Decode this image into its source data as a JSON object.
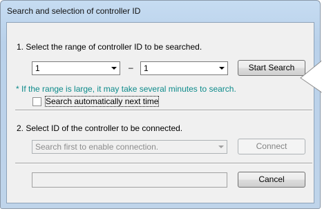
{
  "window": {
    "title": "Search and selection of controller ID"
  },
  "step1": {
    "label": "1. Select the range of controller ID to be searched.",
    "range_from": "1",
    "range_separator": "–",
    "range_to": "1",
    "start_search_label": "Start Search",
    "hint": "* If the range is large, it may take several minutes to search.",
    "auto_search_label": "Search automatically next time",
    "auto_search_checked": false
  },
  "step2": {
    "label": "2. Select ID of the controller to be connected.",
    "controller_select_value": "Search first to enable connection.",
    "connect_label": "Connect"
  },
  "footer": {
    "status_text": "",
    "cancel_label": "Cancel"
  },
  "colors": {
    "hint": "#0c8a8a",
    "titlebar": "#c6dcf2"
  }
}
